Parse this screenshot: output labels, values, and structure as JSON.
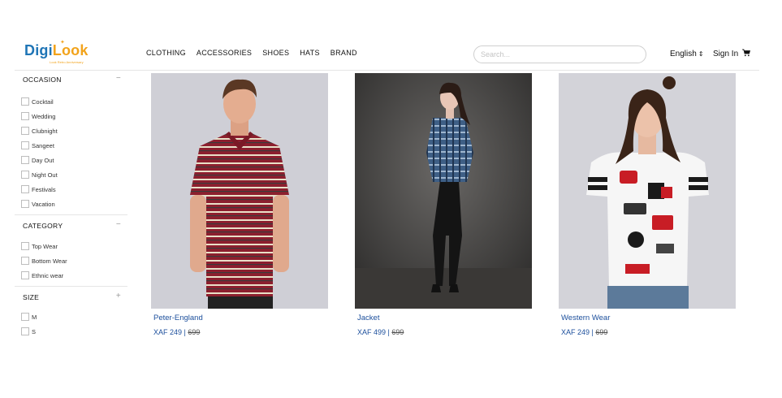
{
  "brand": {
    "part1": "Digi",
    "part2": "Look",
    "tagline": "Look Retro Anniversary"
  },
  "nav": [
    "CLOTHING",
    "ACCESSORIES",
    "SHOES",
    "HATS",
    "BRAND"
  ],
  "search": {
    "placeholder": "Search...",
    "value": ""
  },
  "language": "English",
  "signin": "Sign In",
  "filters": [
    {
      "title": "OCCASION",
      "toggle": "−",
      "options": [
        "Cocktail",
        "Wedding",
        "Clubnight",
        "Sangeet",
        "Day Out",
        "Night Out",
        "Festivals",
        "Vacation"
      ]
    },
    {
      "title": "CATEGORY",
      "toggle": "−",
      "options": [
        "Top Wear",
        "Bottom Wear",
        "Ethnic wear"
      ]
    },
    {
      "title": "SIZE",
      "toggle": "+",
      "options": [
        "M",
        "S"
      ]
    }
  ],
  "products": [
    {
      "name": "Peter-England",
      "price": "XAF 249 | ",
      "old_price": "699",
      "image": "man-striped-polo-photo"
    },
    {
      "name": "Jacket",
      "price": "XAF 499 | ",
      "old_price": "699",
      "image": "woman-plaid-shirt-photo"
    },
    {
      "name": "Western Wear",
      "price": "XAF 249 | ",
      "old_price": "699",
      "image": "woman-graphic-tee-photo"
    }
  ],
  "colors": {
    "link": "#1c4f9c",
    "logo_blue": "#1f75b6",
    "logo_orange": "#f2a31b"
  }
}
